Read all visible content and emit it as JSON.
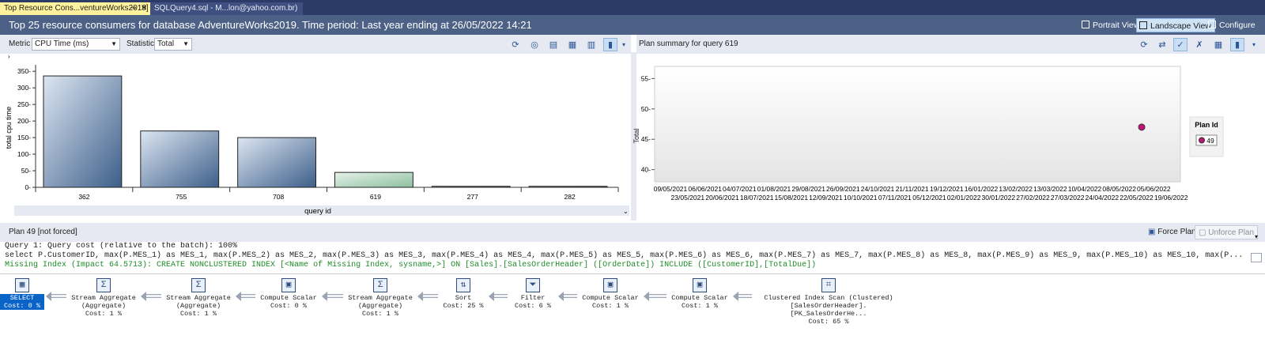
{
  "tabs": [
    {
      "label": "Top Resource Cons...ventureWorks2019]",
      "active": true
    },
    {
      "label": "SQLQuery4.sql - M...lon@yahoo.com.br)",
      "active": false
    }
  ],
  "header": {
    "title": "Top 25 resource consumers for database AdventureWorks2019. Time period: Last year ending at 26/05/2022 14:21",
    "portrait_label": "Portrait View",
    "landscape_label": "Landscape View",
    "configure_label": "Configure"
  },
  "left_toolbar": {
    "metric_label": "Metric",
    "metric_value": "CPU Time (ms)",
    "statistic_label": "Statistic",
    "statistic_value": "Total"
  },
  "right_toolbar": {
    "title": "Plan summary for query 619"
  },
  "colors": {
    "tab_active": "#fff29d",
    "titlebar": "#4d6085",
    "bar_blue": "#3d5f8a",
    "bar_green": "#8cbf9e",
    "plan_point": "#c3117a"
  },
  "chart_data": [
    {
      "type": "bar",
      "categories": [
        "362",
        "755",
        "708",
        "619",
        "277",
        "282"
      ],
      "values": [
        336,
        170,
        150,
        45,
        3,
        3
      ],
      "highlight": "619",
      "ylabel": "total cpu time",
      "xlabel": "query id",
      "yticks": [
        "0",
        "50",
        "100",
        "150",
        "200",
        "250",
        "300",
        "350"
      ],
      "ylim": [
        0,
        360
      ]
    },
    {
      "type": "scatter",
      "ylabel": "Total",
      "yticks": [
        "40",
        "45",
        "50",
        "55"
      ],
      "ylim": [
        38,
        57
      ],
      "x_top_labels": [
        "09/05/2021",
        "06/06/2021",
        "04/07/2021",
        "01/08/2021",
        "29/08/2021",
        "26/09/2021",
        "24/10/2021",
        "21/11/2021",
        "19/12/2021",
        "16/01/2022",
        "13/02/2022",
        "13/03/2022",
        "10/04/2022",
        "08/05/2022",
        "05/06/2022"
      ],
      "x_bottom_labels": [
        "23/05/2021",
        "20/06/2021",
        "18/07/2021",
        "15/08/2021",
        "12/09/2021",
        "10/10/2021",
        "07/11/2021",
        "05/12/2021",
        "02/01/2022",
        "30/01/2022",
        "27/02/2022",
        "27/03/2022",
        "24/04/2022",
        "22/05/2022",
        "19/06/2022"
      ],
      "points": [
        {
          "x": "26/05/2022",
          "y": 47,
          "plan": "49"
        }
      ],
      "legend_title": "Plan Id",
      "legend_items": [
        "49"
      ]
    }
  ],
  "plan": {
    "status_label": "Plan 49 [not forced]",
    "force_label": "Force Plan",
    "unforce_label": "Unforce Plan",
    "line1": "Query 1: Query cost (relative to the batch): 100%",
    "line2": "select P.CustomerID, max(P.MES_1) as MES_1, max(P.MES_2) as MES_2, max(P.MES_3) as MES_3, max(P.MES_4) as MES_4, max(P.MES_5) as MES_5, max(P.MES_6) as MES_6, max(P.MES_7) as MES_7, max(P.MES_8) as MES_8, max(P.MES_9) as MES_9, max(P.MES_10) as MES_10, max(P...",
    "line3": "Missing Index (Impact 64.5713): CREATE NONCLUSTERED INDEX [<Name of Missing Index, sysname,>] ON [Sales].[SalesOrderHeader] ([OrderDate]) INCLUDE ([CustomerID],[TotalDue])",
    "operators": [
      {
        "name": "SELECT",
        "sub": "",
        "cost": "Cost: 0 %",
        "icon": "select-icon"
      },
      {
        "name": "Stream Aggregate",
        "sub": "(Aggregate)",
        "cost": "Cost: 1 %",
        "icon": "stream-aggregate-icon"
      },
      {
        "name": "Stream Aggregate",
        "sub": "(Aggregate)",
        "cost": "Cost: 1 %",
        "icon": "stream-aggregate-icon"
      },
      {
        "name": "Compute Scalar",
        "sub": "",
        "cost": "Cost: 0 %",
        "icon": "compute-scalar-icon"
      },
      {
        "name": "Stream Aggregate",
        "sub": "(Aggregate)",
        "cost": "Cost: 1 %",
        "icon": "stream-aggregate-icon"
      },
      {
        "name": "Sort",
        "sub": "",
        "cost": "Cost: 25 %",
        "icon": "sort-icon"
      },
      {
        "name": "Filter",
        "sub": "",
        "cost": "Cost: 6 %",
        "icon": "filter-icon"
      },
      {
        "name": "Compute Scalar",
        "sub": "",
        "cost": "Cost: 1 %",
        "icon": "compute-scalar-icon"
      },
      {
        "name": "Compute Scalar",
        "sub": "",
        "cost": "Cost: 1 %",
        "icon": "compute-scalar-icon"
      },
      {
        "name": "Clustered Index Scan (Clustered)",
        "sub": "[SalesOrderHeader].[PK_SalesOrderHe...",
        "cost": "Cost: 65 %",
        "icon": "clustered-index-scan-icon"
      }
    ]
  }
}
